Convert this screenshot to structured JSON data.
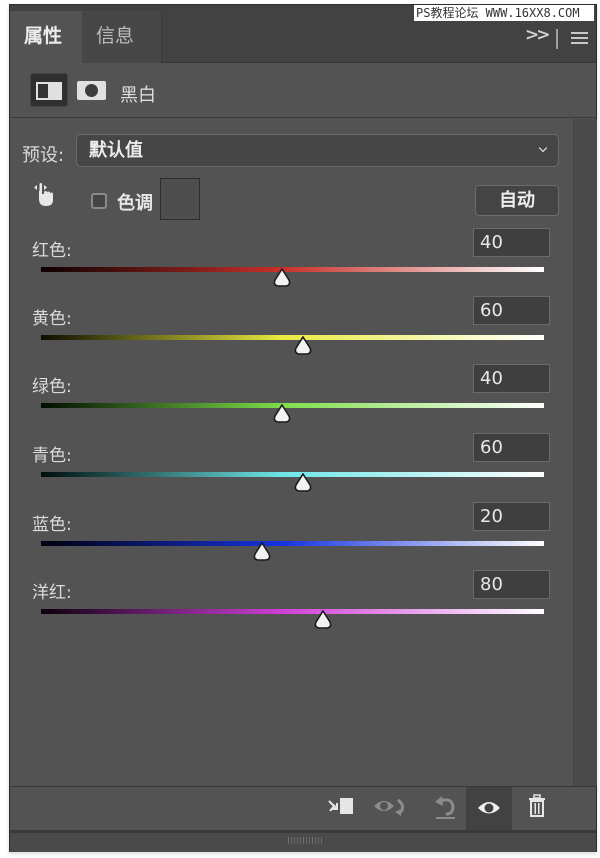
{
  "tabs": [
    {
      "label": "属性",
      "active": true
    },
    {
      "label": "信息",
      "active": false
    }
  ],
  "tab_controls": {
    "expand": "expand-icon",
    "menu": "menu-icon"
  },
  "adjustment": {
    "title": "黑白",
    "icons": [
      "adjustment-layer-icon",
      "layer-mask-icon"
    ]
  },
  "preset": {
    "label": "预设:",
    "value": "默认值"
  },
  "targeted_adjust_icon": "hand-scrub-icon",
  "tint": {
    "label": "色调",
    "checked": false,
    "swatch_color": "#4e4e4e"
  },
  "auto_button": "自动",
  "slider_range": {
    "min": -200,
    "max": 300
  },
  "sliders": [
    {
      "label": "红色:",
      "value": "40",
      "colors": [
        "#0d0000",
        "#c8302a",
        "#ffffff"
      ]
    },
    {
      "label": "黄色:",
      "value": "60",
      "colors": [
        "#0d0d00",
        "#eaea40",
        "#ffffff"
      ]
    },
    {
      "label": "绿色:",
      "value": "40",
      "colors": [
        "#000d00",
        "#7ede4a",
        "#ffffff"
      ]
    },
    {
      "label": "青色:",
      "value": "60",
      "colors": [
        "#000d0d",
        "#6ee6e6",
        "#ffffff"
      ]
    },
    {
      "label": "蓝色:",
      "value": "20",
      "colors": [
        "#00000d",
        "#1633e0",
        "#ffffff"
      ]
    },
    {
      "label": "洋红:",
      "value": "80",
      "colors": [
        "#0d000d",
        "#d040d8",
        "#ffffff"
      ]
    }
  ],
  "footer_buttons": [
    {
      "name": "clip-to-layer-icon",
      "active": false
    },
    {
      "name": "view-previous-state-icon",
      "active": false
    },
    {
      "name": "reset-icon",
      "active": false
    },
    {
      "name": "visibility-eye-icon",
      "active": true
    },
    {
      "name": "trash-icon",
      "active": false
    }
  ],
  "watermark": "PS教程论坛 WWW.16XX8.COM"
}
